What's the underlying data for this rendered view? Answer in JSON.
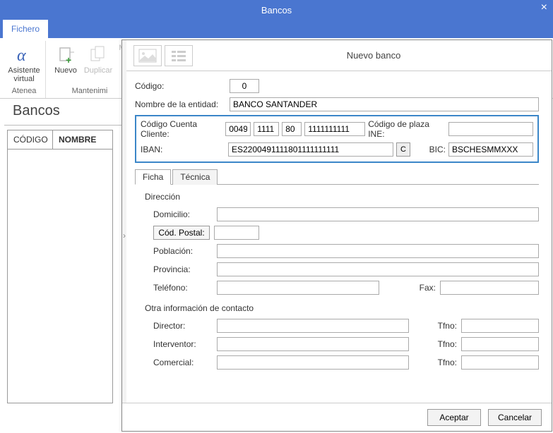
{
  "window": {
    "title": "Bancos",
    "close": "×"
  },
  "menu": {
    "fichero": "Fichero"
  },
  "ribbon": {
    "asistente": "Asistente virtual",
    "atenea": "Atenea",
    "nuevo": "Nuevo",
    "duplicar": "Duplicar",
    "mas": "M",
    "mantenimiento": "Mantenimi"
  },
  "main": {
    "heading": "Bancos",
    "col_codigo": "CÓDIGO",
    "col_nombre": "NOMBRE"
  },
  "dialog": {
    "title": "Nuevo banco",
    "codigo_label": "Código:",
    "codigo_value": "0",
    "nombre_label": "Nombre de la entidad:",
    "nombre_value": "BANCO SANTANDER",
    "ccc_label": "Código Cuenta Cliente:",
    "ccc1": "0049",
    "ccc2": "1111",
    "ccc3": "80",
    "ccc4": "1111111111",
    "plaza_label": "Código de plaza INE:",
    "plaza_value": "",
    "iban_label": "IBAN:",
    "iban_value": "ES2200491111801111111111",
    "iban_calc": "C",
    "bic_label": "BIC:",
    "bic_value": "BSCHESMMXXX",
    "tabs": {
      "ficha": "Ficha",
      "tecnica": "Técnica"
    },
    "direccion": {
      "title": "Dirección",
      "domicilio_label": "Domicilio:",
      "cod_postal_label": "Cód. Postal:",
      "poblacion_label": "Población:",
      "provincia_label": "Provincia:",
      "telefono_label": "Teléfono:",
      "fax_label": "Fax:"
    },
    "contacto": {
      "title": "Otra información de contacto",
      "director_label": "Director:",
      "interventor_label": "Interventor:",
      "comercial_label": "Comercial:",
      "tfno_label": "Tfno:"
    },
    "footer": {
      "aceptar": "Aceptar",
      "cancelar": "Cancelar"
    }
  }
}
